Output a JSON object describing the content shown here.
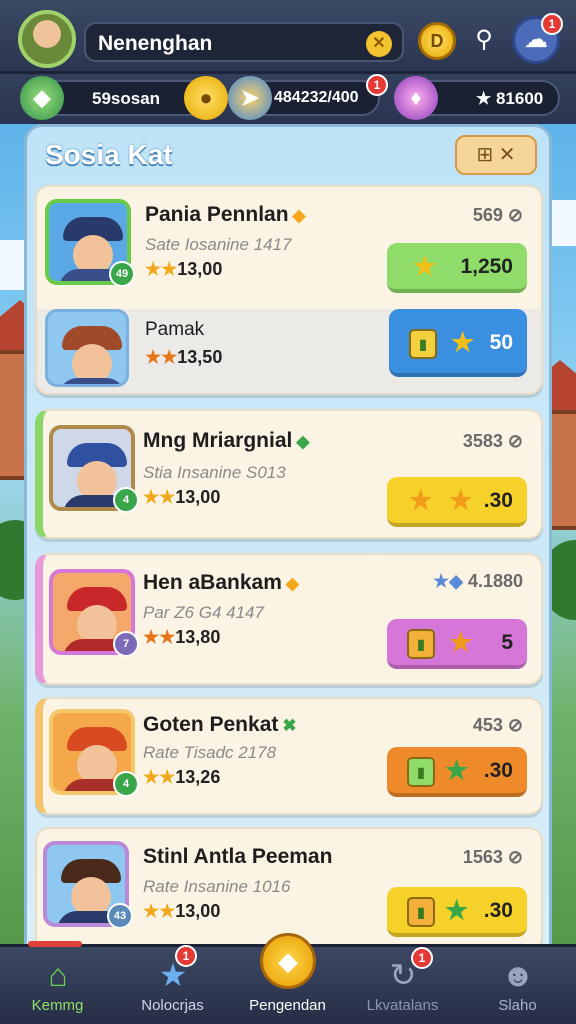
{
  "header": {
    "player_name": "Nenenghan",
    "name_badge_icon": "chevron-x-badge-icon",
    "coin_icon_label": "D",
    "settings_notification": "1"
  },
  "currencies": [
    {
      "icon": "gem-icon",
      "value": "59sosan"
    },
    {
      "icon": "compass-icon",
      "value": "484232/400",
      "badge": "1"
    },
    {
      "icon": "potion-icon",
      "value": "★ 81600"
    }
  ],
  "panel": {
    "title": "Sosia Kat",
    "tools_label": "⊞ ✕"
  },
  "cards": [
    {
      "name": "Pania Pennlan",
      "sub": "Sate Iosanine 1417",
      "rating": "13,00",
      "count": "569",
      "level": "49",
      "button_value": "1,250",
      "button_color": "#8fdc6a",
      "sub_row": {
        "name": "Pamak",
        "rating": "13,50",
        "button_value": "50"
      }
    },
    {
      "name": "Mng Mriargnial",
      "sub": "Stia Insanine S013",
      "rating": "13,00",
      "count": "3583",
      "level": "4",
      "button_value": ".30",
      "button_color": "#f6d12a"
    },
    {
      "name": "Hen aBankam",
      "sub": "Par Z6 G4 4147",
      "rating": "13,80",
      "count": "4.1880",
      "level": "7",
      "button_value": "5",
      "button_color": "#d776d9"
    },
    {
      "name": "Goten Penkat",
      "sub": "Rate Tisadc 2178",
      "rating": "13,26",
      "count": "453",
      "level": "4",
      "button_value": ".30",
      "button_color": "#ef8a2a"
    },
    {
      "name": "Stinl Antla Peeman",
      "sub": "Rate Insanine 1016",
      "rating": "13,00",
      "count": "1563",
      "level": "43",
      "button_value": ".30",
      "button_color": "#f6d12a"
    }
  ],
  "nav": [
    {
      "label": "Kemmg",
      "icon": "home-icon",
      "active": true
    },
    {
      "label": "Nolocrjas",
      "icon": "star-icon",
      "badge": "1"
    },
    {
      "label": "Pengendan",
      "icon": "chat-badge-icon"
    },
    {
      "label": "Lkvatalans",
      "icon": "refresh-icon",
      "badge": "1"
    },
    {
      "label": "Slaho",
      "icon": "profile-icon"
    }
  ],
  "colors": {
    "topbar": "#2b3550",
    "panel": "#bfe3f7",
    "card": "#fbf3e4",
    "accent_red": "#e53935"
  }
}
